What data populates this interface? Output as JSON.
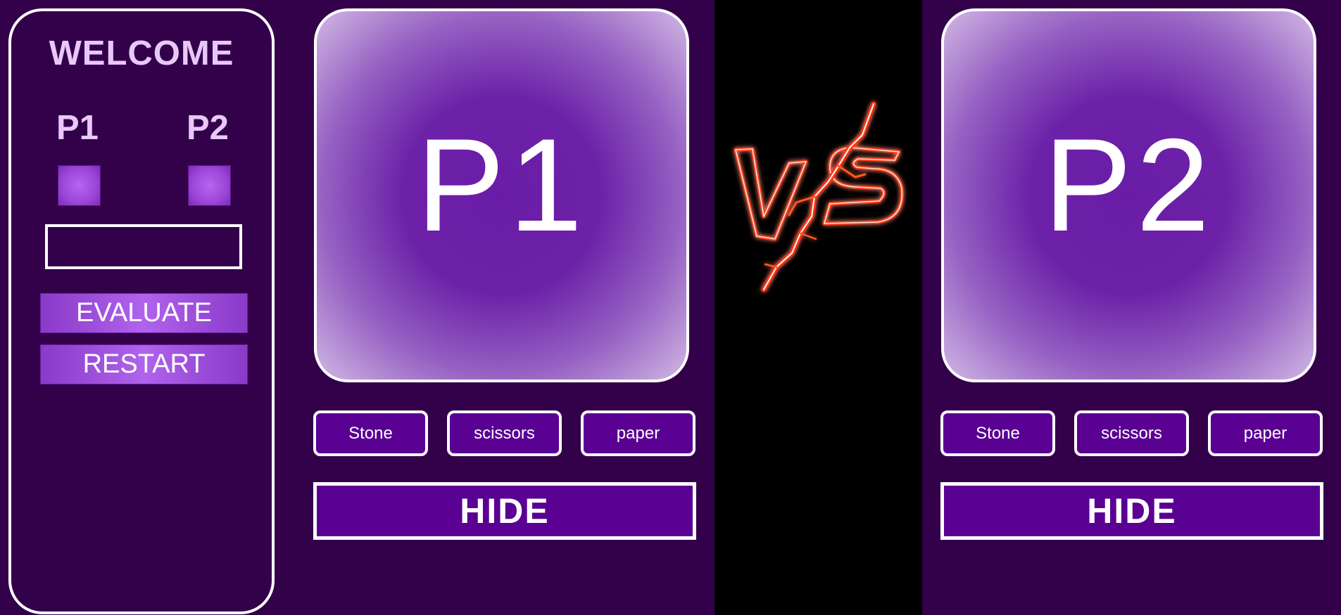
{
  "sidebar": {
    "welcome": "WELCOME",
    "player1_label": "P1",
    "player2_label": "P2",
    "result_text": "",
    "evaluate_label": "EVALUATE",
    "restart_label": "RESTART"
  },
  "player1": {
    "card_label": "P1",
    "choices": [
      "Stone",
      "scissors",
      "paper"
    ],
    "hide_label": "HIDE"
  },
  "player2": {
    "card_label": "P2",
    "choices": [
      "Stone",
      "scissors",
      "paper"
    ],
    "hide_label": "HIDE"
  },
  "colors": {
    "background": "#33004a",
    "button": "#5a0093",
    "accent_light": "#e8c8f8",
    "vs_glow": "#ff3a1a"
  },
  "vs_graphic": {
    "icon": "vs-lightning-icon"
  }
}
